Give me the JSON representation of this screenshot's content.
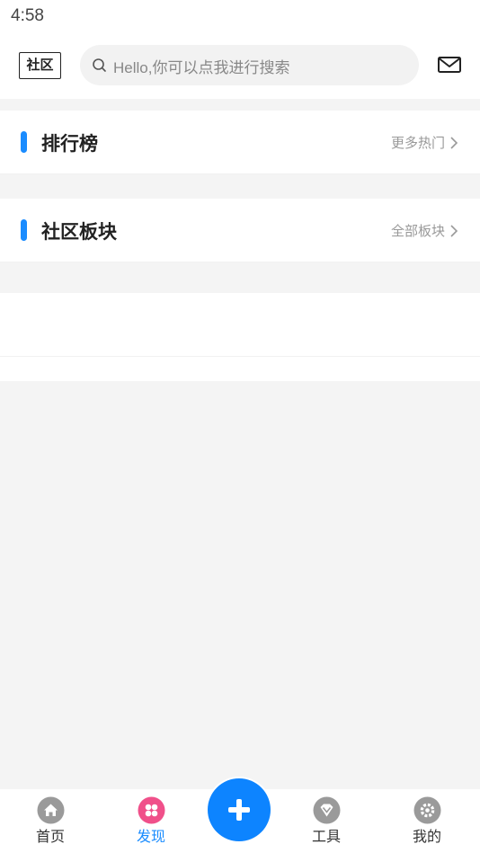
{
  "status_bar": {
    "time": "4:58"
  },
  "header": {
    "logo_text": "社区",
    "search_placeholder": "Hello,你可以点我进行搜索",
    "search_icon": "search-icon",
    "mail_icon": "mail-icon"
  },
  "sections": [
    {
      "title": "排行榜",
      "more_label": "更多热门"
    },
    {
      "title": "社区板块",
      "more_label": "全部板块"
    }
  ],
  "bottom_nav": {
    "items": [
      {
        "label": "首页",
        "icon": "home-icon",
        "active": false
      },
      {
        "label": "发现",
        "icon": "discover-icon",
        "active": true
      },
      {
        "label": "工具",
        "icon": "tools-icon",
        "active": false
      },
      {
        "label": "我的",
        "icon": "settings-icon",
        "active": false
      }
    ],
    "fab_icon": "plus-icon"
  },
  "colors": {
    "accent": "#1a8cff",
    "discover_pink": "#f0508a",
    "background": "#f4f4f4"
  }
}
